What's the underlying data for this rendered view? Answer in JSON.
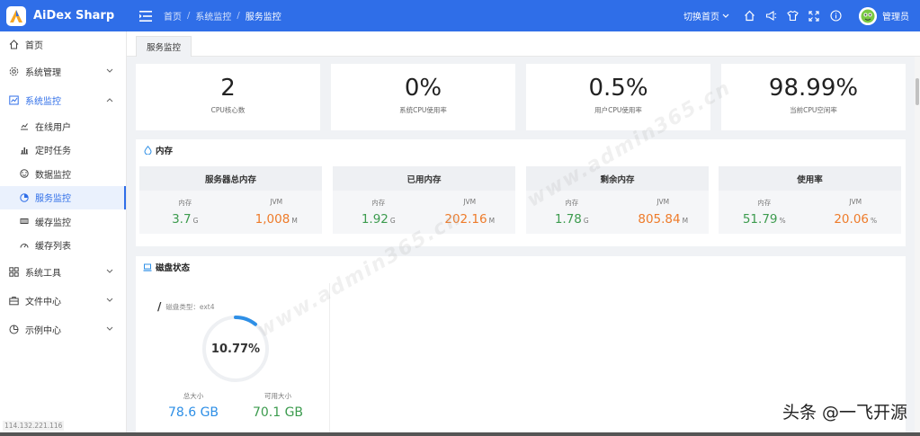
{
  "header": {
    "app_name": "AiDex Sharp",
    "breadcrumb": [
      "首页",
      "系统监控",
      "服务监控"
    ],
    "switch_home": "切换首页",
    "username": "管理员",
    "accent_color": "#2f6ee8"
  },
  "sidebar": {
    "items": [
      {
        "label": "首页",
        "icon": "home-icon"
      },
      {
        "label": "系统管理",
        "icon": "gear-icon"
      },
      {
        "label": "系统监控",
        "icon": "monitor-chart-icon"
      },
      {
        "label": "系统工具",
        "icon": "grid-icon"
      },
      {
        "label": "文件中心",
        "icon": "briefcase-icon"
      },
      {
        "label": "示例中心",
        "icon": "pie-icon"
      }
    ],
    "monitor_children": [
      {
        "label": "在线用户",
        "icon": "user-chart-icon"
      },
      {
        "label": "定时任务",
        "icon": "bar-chart-icon"
      },
      {
        "label": "数据监控",
        "icon": "dashboard-icon"
      },
      {
        "label": "服务监控",
        "icon": "pie-chart-icon"
      },
      {
        "label": "缓存监控",
        "icon": "cache-icon"
      },
      {
        "label": "缓存列表",
        "icon": "gauge-icon"
      }
    ],
    "ip": "114.132.221.116"
  },
  "tabs": [
    {
      "label": "服务监控"
    }
  ],
  "cpu": [
    {
      "value": "2",
      "label": "CPU核心数"
    },
    {
      "value": "0%",
      "label": "系统CPU使用率"
    },
    {
      "value": "0.5%",
      "label": "用户CPU使用率"
    },
    {
      "value": "98.99%",
      "label": "当前CPU空闲率"
    }
  ],
  "memory": {
    "title": "内存",
    "sub_mem": "内存",
    "sub_jvm": "JVM",
    "cards": [
      {
        "title": "服务器总内存",
        "mem": "3.7",
        "mem_unit": "G",
        "jvm": "1,008",
        "jvm_unit": "M"
      },
      {
        "title": "已用内存",
        "mem": "1.92",
        "mem_unit": "G",
        "jvm": "202.16",
        "jvm_unit": "M"
      },
      {
        "title": "剩余内存",
        "mem": "1.78",
        "mem_unit": "G",
        "jvm": "805.84",
        "jvm_unit": "M"
      },
      {
        "title": "使用率",
        "mem": "51.79",
        "mem_unit": "%",
        "jvm": "20.06",
        "jvm_unit": "%"
      }
    ]
  },
  "disk": {
    "title": "磁盘状态",
    "path": "/",
    "type_label": "磁盘类型：ext4",
    "usage_percent": "10.77%",
    "usage_fraction": 0.1077,
    "total_label": "总大小",
    "total_value": "78.6 GB",
    "free_label": "可用大小",
    "free_value": "70.1 GB"
  },
  "watermark": "www.admin365.cn",
  "byline": "头条 @一飞开源"
}
